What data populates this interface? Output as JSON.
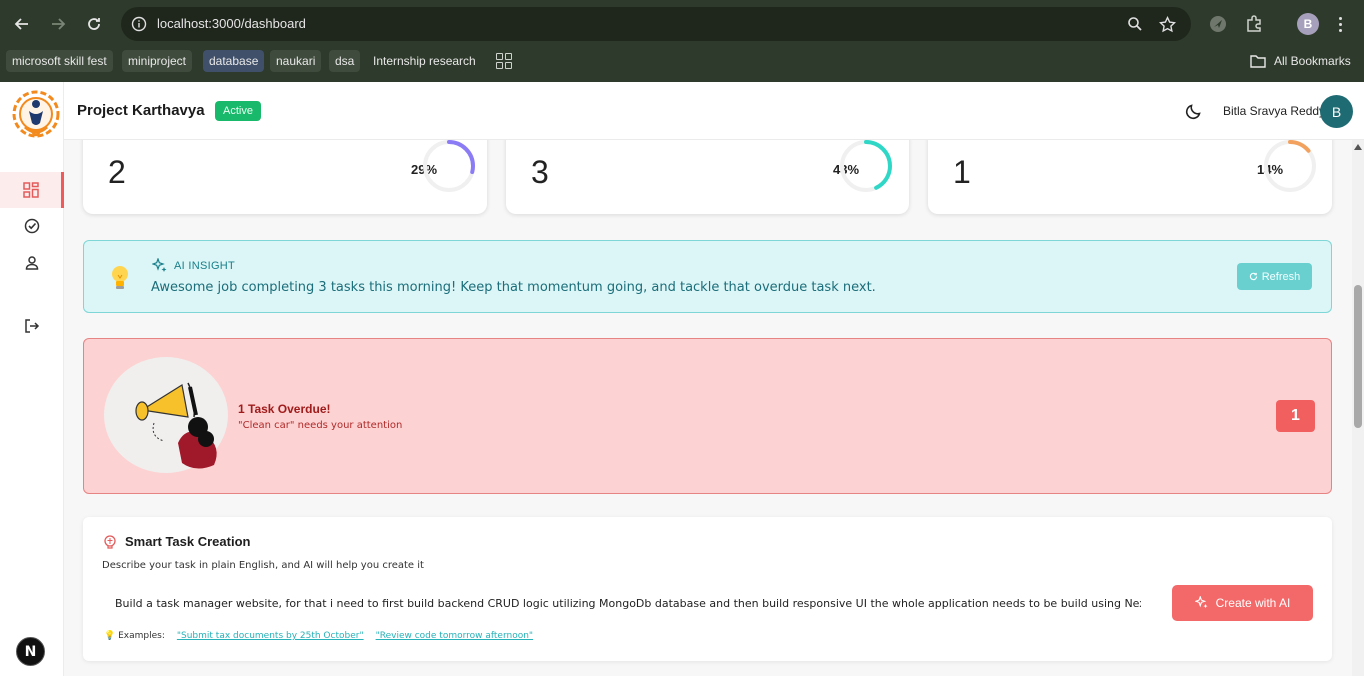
{
  "browser": {
    "url": "localhost:3000/dashboard",
    "profile_initial": "B",
    "bookmarks": [
      "microsoft skill fest",
      "miniproject",
      "database",
      "naukari",
      "dsa",
      "Internship research"
    ],
    "all_bookmarks_label": "All Bookmarks",
    "icons": [
      "back-icon",
      "forward-icon",
      "reload-icon",
      "info-icon",
      "zoom-icon",
      "star-icon",
      "extension-icon",
      "puzzle-icon",
      "apps-icon",
      "folder-icon"
    ]
  },
  "header": {
    "project_title": "Project Karthavya",
    "status": "Active",
    "user_name": "Bitla Sravya Reddy",
    "avatar_initial": "B"
  },
  "sidebar": {
    "items": [
      "dashboard-icon",
      "tasks-icon",
      "profile-icon",
      "logout-icon"
    ],
    "bottom_badge": "N"
  },
  "stats": [
    {
      "value": "2",
      "percent": "29%",
      "fraction": 0.29,
      "color": "#8b7cf6"
    },
    {
      "value": "3",
      "percent": "43%",
      "fraction": 0.43,
      "color": "#2fd7c7"
    },
    {
      "value": "1",
      "percent": "14%",
      "fraction": 0.14,
      "color": "#f2a25e"
    }
  ],
  "ai_insight": {
    "label": "AI INSIGHT",
    "text": "Awesome job completing 3 tasks this morning! Keep that momentum going, and tackle that overdue task next.",
    "refresh_label": "Refresh"
  },
  "overdue": {
    "title": "1 Task Overdue!",
    "subtitle": "\"Clean car\" needs your attention",
    "count": "1"
  },
  "smart_task": {
    "title": "Smart Task Creation",
    "description": "Describe your task in plain English, and AI will help you create it",
    "input_value": "Build a task manager website, for that i need to first build backend CRUD logic utilizing MongoDb database and then build responsive UI the whole application needs to be build using Next.js",
    "create_label": "Create with AI",
    "examples_label": "Examples:",
    "examples": [
      "\"Submit tax documents by 25th October\"",
      "\"Review code tomorrow afternoon\""
    ]
  },
  "colors": {
    "accent": "#f36868",
    "teal": "#2fb8c0",
    "active_pill": "#19b96b"
  }
}
